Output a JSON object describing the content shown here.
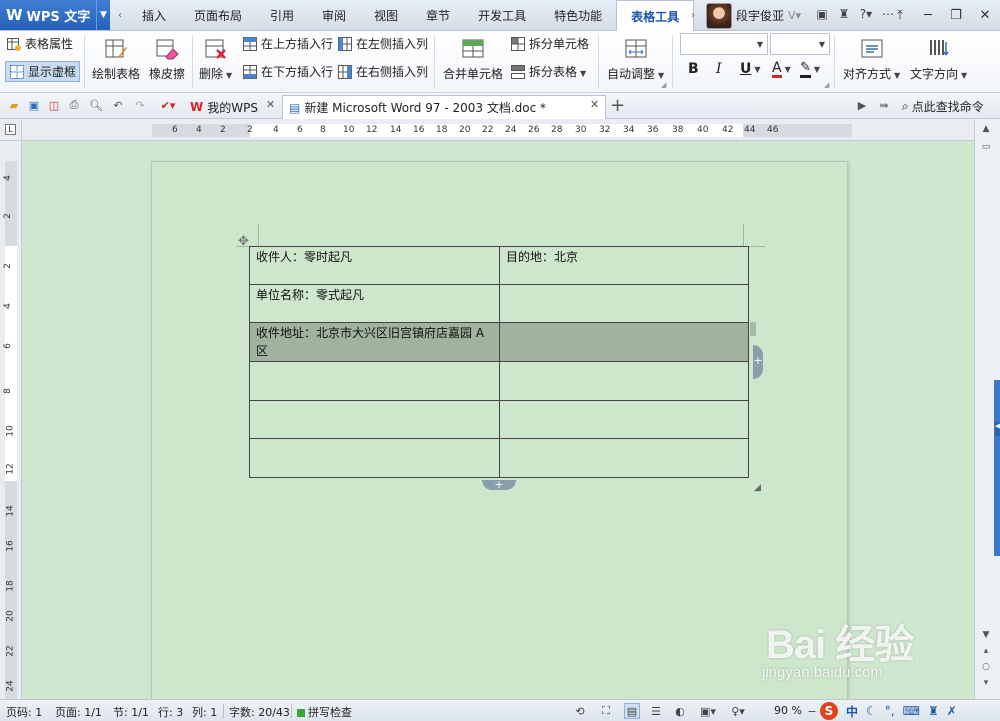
{
  "app": {
    "name": "WPS 文字"
  },
  "menu": {
    "tabs": [
      {
        "label": "插入"
      },
      {
        "label": "页面布局"
      },
      {
        "label": "引用"
      },
      {
        "label": "审阅"
      },
      {
        "label": "视图"
      },
      {
        "label": "章节"
      },
      {
        "label": "开发工具"
      },
      {
        "label": "特色功能"
      },
      {
        "label": "表格工具",
        "active": true
      }
    ]
  },
  "user": {
    "name": "段宇俊亚"
  },
  "ribbon": {
    "table_props": "表格属性",
    "show_gridlines": "显示虚框",
    "draw_table": "绘制表格",
    "eraser": "橡皮擦",
    "delete": "删除",
    "insert_above": "在上方插入行",
    "insert_below": "在下方插入行",
    "insert_left": "在左侧插入列",
    "insert_right": "在右侧插入列",
    "merge_cells": "合并单元格",
    "split_cells": "拆分单元格",
    "split_table": "拆分表格",
    "autofit": "自动调整",
    "align": "对齐方式",
    "text_direction": "文字方向",
    "font_name": "",
    "font_size": "",
    "bold": "B",
    "italic": "I",
    "underline": "U",
    "font_color": "A"
  },
  "tabs": {
    "home": "我的WPS",
    "doc": "新建 Microsoft Word 97 - 2003 文档.doc *",
    "find_placeholder": "点此查找命令"
  },
  "ruler": {
    "h_ticks": [
      "6",
      "4",
      "2",
      "2",
      "4",
      "6",
      "8",
      "10",
      "12",
      "14",
      "16",
      "18",
      "20",
      "22",
      "24",
      "26",
      "28",
      "30",
      "32",
      "34",
      "36",
      "38",
      "40",
      "42",
      "44",
      "46"
    ],
    "v_ticks": [
      "4",
      "2",
      "2",
      "4",
      "6",
      "8",
      "10",
      "12",
      "14",
      "16",
      "18",
      "20",
      "22",
      "24"
    ]
  },
  "table": {
    "rows": [
      [
        "收件人：零时起凡",
        "目的地：北京"
      ],
      [
        "单位名称：零式起凡",
        ""
      ],
      [
        "收件地址：北京市大兴区旧宫镇府店嘉园 A 区",
        ""
      ],
      [
        "",
        ""
      ],
      [
        "",
        ""
      ],
      [
        "",
        ""
      ]
    ],
    "selected_row": 2
  },
  "status": {
    "page": "页码: 1",
    "pages": "页面: 1/1",
    "section": "节: 1/1",
    "row": "行: 3",
    "col": "列: 1",
    "wordcount": "字数: 20/43",
    "spell": "拼写检查",
    "zoom": "90 %",
    "ime_lang": "中"
  },
  "watermark": {
    "main": "Bai 经验",
    "sub": "jingyan.baidu.com"
  }
}
